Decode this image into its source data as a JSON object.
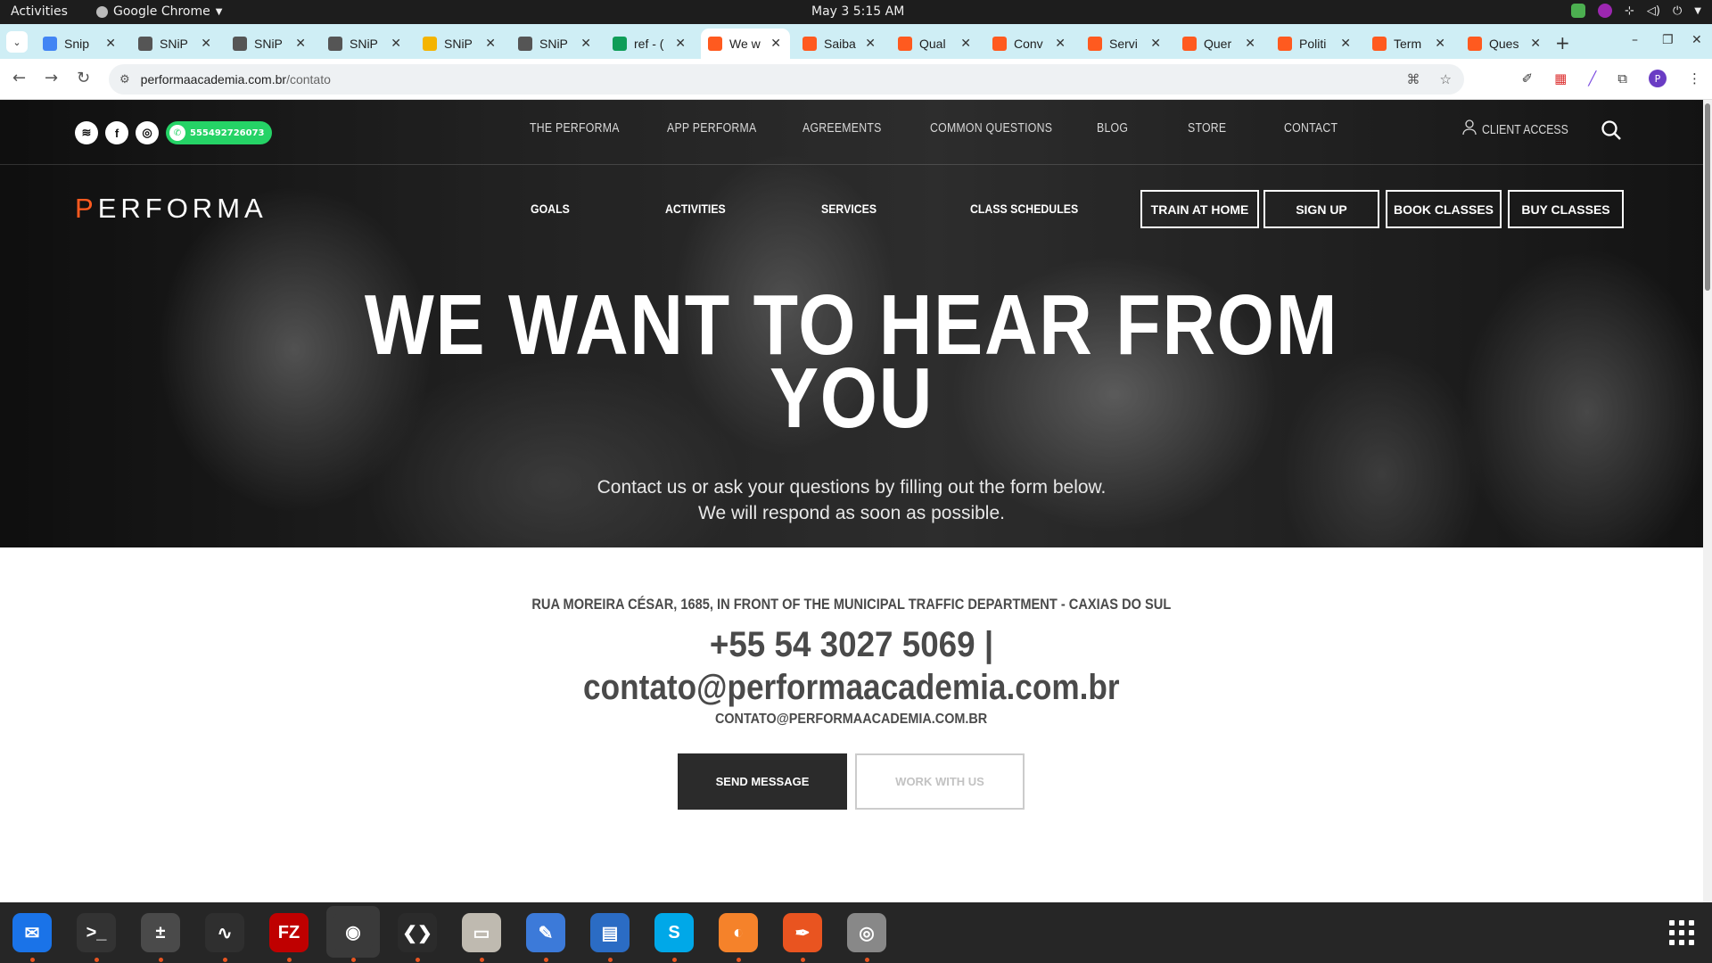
{
  "system": {
    "activities": "Activities",
    "app_name": "Google Chrome",
    "clock": "May 3  5:15 AM"
  },
  "tabs": [
    {
      "title": "Snip",
      "favicon": "docs-icon",
      "color": "#4285f4"
    },
    {
      "title": "SNiP",
      "favicon": "snip-icon",
      "color": "#555555"
    },
    {
      "title": "SNiP",
      "favicon": "snip-icon",
      "color": "#555555"
    },
    {
      "title": "SNiP",
      "favicon": "snip-icon",
      "color": "#555555"
    },
    {
      "title": "SNiP",
      "favicon": "chrome-web-icon",
      "color": "#f4b400"
    },
    {
      "title": "SNiP",
      "favicon": "snip-icon",
      "color": "#555555"
    },
    {
      "title": "ref - (",
      "favicon": "sheets-icon",
      "color": "#0f9d58"
    },
    {
      "title": "We w",
      "favicon": "performa-icon",
      "color": "#ff5a1f",
      "active": true
    },
    {
      "title": "Saiba",
      "favicon": "performa-icon",
      "color": "#ff5a1f"
    },
    {
      "title": "Qual",
      "favicon": "performa-icon",
      "color": "#ff5a1f"
    },
    {
      "title": "Conv",
      "favicon": "performa-icon",
      "color": "#ff5a1f"
    },
    {
      "title": "Servi",
      "favicon": "performa-icon",
      "color": "#ff5a1f"
    },
    {
      "title": "Quer",
      "favicon": "performa-icon",
      "color": "#ff5a1f"
    },
    {
      "title": "Politi",
      "favicon": "performa-icon",
      "color": "#ff5a1f"
    },
    {
      "title": "Term",
      "favicon": "performa-icon",
      "color": "#ff5a1f"
    },
    {
      "title": "Ques",
      "favicon": "performa-icon",
      "color": "#ff5a1f"
    }
  ],
  "toolbar": {
    "url_host": "performaacademia.com.br",
    "url_path": "/contato",
    "profile_initial": "P"
  },
  "site": {
    "whatsapp_number": "555492726073",
    "topnav": [
      "THE PERFORMA",
      "APP PERFORMA",
      "AGREEMENTS",
      "COMMON QUESTIONS",
      "BLOG",
      "STORE",
      "CONTACT"
    ],
    "client_access": "CLIENT ACCESS",
    "logo": "ERFORMA",
    "logo_p": "P",
    "mainnav": [
      "GOALS",
      "ACTIVITIES",
      "SERVICES",
      "CLASS SCHEDULES"
    ],
    "cta_buttons": [
      "TRAIN AT HOME",
      "SIGN UP",
      "BOOK CLASSES",
      "BUY CLASSES"
    ],
    "brand_color": "#ff5a1f"
  },
  "hero": {
    "title_line1": "WE WANT TO HEAR FROM",
    "title_line2": "YOU",
    "subtitle_line1": "Contact us or ask your questions by filling out the form below.",
    "subtitle_line2": "We will respond as soon as possible."
  },
  "contact": {
    "address": "RUA MOREIRA CÉSAR, 1685, IN FRONT OF THE MUNICIPAL TRAFFIC DEPARTMENT - CAXIAS DO SUL",
    "phone": "+55 54 3027 5069   |",
    "email": "contato@performaacademia.com.br",
    "email_caps": "CONTATO@PERFORMAACADEMIA.COM.BR",
    "send_button": "SEND MESSAGE",
    "work_button": "WORK WITH US"
  },
  "dock": [
    {
      "name": "thunderbird-icon",
      "color": "#1a73e8",
      "glyph": "✉"
    },
    {
      "name": "terminal-icon",
      "color": "#333333",
      "glyph": ">_"
    },
    {
      "name": "calculator-icon",
      "color": "#4a4a4a",
      "glyph": "±"
    },
    {
      "name": "system-monitor-icon",
      "color": "#2f2f2f",
      "glyph": "∿"
    },
    {
      "name": "filezilla-icon",
      "color": "#bf0000",
      "glyph": "FZ"
    },
    {
      "name": "chrome-icon",
      "color": "#3a3a3a",
      "glyph": "◉"
    },
    {
      "name": "vscode-icon",
      "color": "#2b2b2b",
      "glyph": "❮❯"
    },
    {
      "name": "files-icon",
      "color": "#bfbab0",
      "glyph": "▭"
    },
    {
      "name": "text-editor-icon",
      "color": "#3c7ad9",
      "glyph": "✎"
    },
    {
      "name": "document-viewer-icon",
      "color": "#2b6cc4",
      "glyph": "▤"
    },
    {
      "name": "skype-icon",
      "color": "#00a8e8",
      "glyph": "S"
    },
    {
      "name": "blender-icon",
      "color": "#f5822a",
      "glyph": "◐"
    },
    {
      "name": "inkscape-icon",
      "color": "#e95420",
      "glyph": "✒"
    },
    {
      "name": "disk-icon",
      "color": "#888888",
      "glyph": "◎"
    }
  ]
}
